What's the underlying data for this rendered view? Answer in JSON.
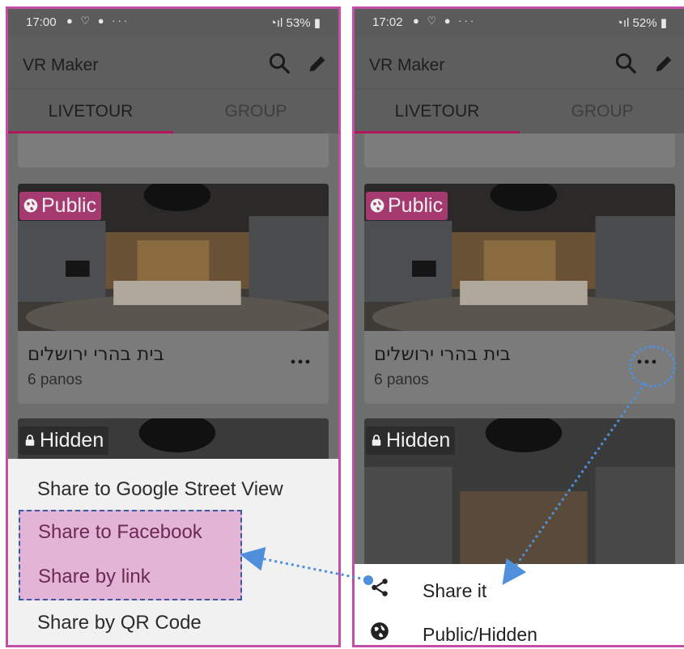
{
  "left_screen": {
    "status": {
      "time": "17:00",
      "battery": "53%"
    },
    "appbar": {
      "title": "VR Maker"
    },
    "tabs": [
      {
        "label": "LIVETOUR"
      },
      {
        "label": "GROUP"
      }
    ],
    "card1": {
      "badge": "Public",
      "title": "בית בהרי ירושלים",
      "subtitle": "6 panos"
    },
    "card2": {
      "badge": "Hidden"
    },
    "share_menu": [
      {
        "label": "Share to Google Street View"
      },
      {
        "label": "Share to Facebook"
      },
      {
        "label": "Share by link"
      },
      {
        "label": "Share by QR Code"
      }
    ]
  },
  "right_screen": {
    "status": {
      "time": "17:02",
      "battery": "52%"
    },
    "appbar": {
      "title": "VR Maker"
    },
    "tabs": [
      {
        "label": "LIVETOUR"
      },
      {
        "label": "GROUP"
      }
    ],
    "card1": {
      "badge": "Public",
      "title": "בית בהרי ירושלים",
      "subtitle": "6 panos",
      "more": "•••"
    },
    "card2": {
      "badge": "Hidden"
    },
    "bottom_menu": [
      {
        "label": "Share it",
        "icon": "share-icon"
      },
      {
        "label": "Public/Hidden",
        "icon": "globe-icon"
      }
    ]
  },
  "colors": {
    "frame": "#c24fa5",
    "tab_indicator": "#b2175e",
    "highlight": "#e4b4d7",
    "annotation": "#4f8fdc"
  }
}
